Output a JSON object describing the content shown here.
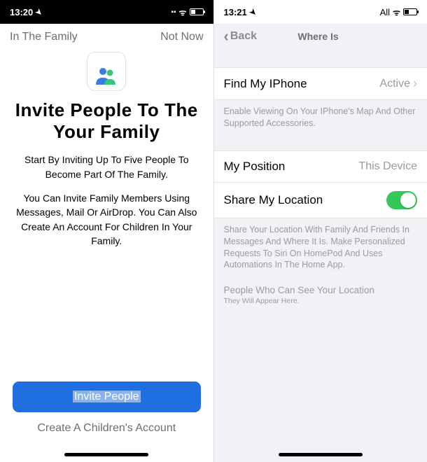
{
  "left": {
    "status": {
      "time": "13:20"
    },
    "topbar": {
      "breadcrumb": "In The Family",
      "not_now": "Not Now"
    },
    "title_line1": "Invite People To The",
    "title_line2": "Your Family",
    "body1": "Start By Inviting Up To Five People To Become Part Of The Family.",
    "body2": "You Can Invite Family Members Using Messages, Mail Or AirDrop. You Can Also Create An Account For Children In Your Family.",
    "invite_button": "Invite People",
    "create_child": "Create A Children's Account"
  },
  "right": {
    "status": {
      "time": "13:21",
      "right_text": "All"
    },
    "nav": {
      "back": "Back",
      "title": "Where Is"
    },
    "find_iphone": {
      "label": "Find My IPhone",
      "value": "Active"
    },
    "find_iphone_footer": "Enable Viewing On Your IPhone's Map And Other Supported Accessories.",
    "my_position": {
      "label": "My Position",
      "value": "This Device"
    },
    "share_location": {
      "label": "Share My Location",
      "on": true
    },
    "share_footer": "Share Your Location With Family And Friends In Messages And Where It Is. Make Personalized Requests To Siri On HomePod And Uses Automations In The Home App.",
    "people_header": "People Who Can See Your Location",
    "people_sub": "They Will Appear Here."
  }
}
